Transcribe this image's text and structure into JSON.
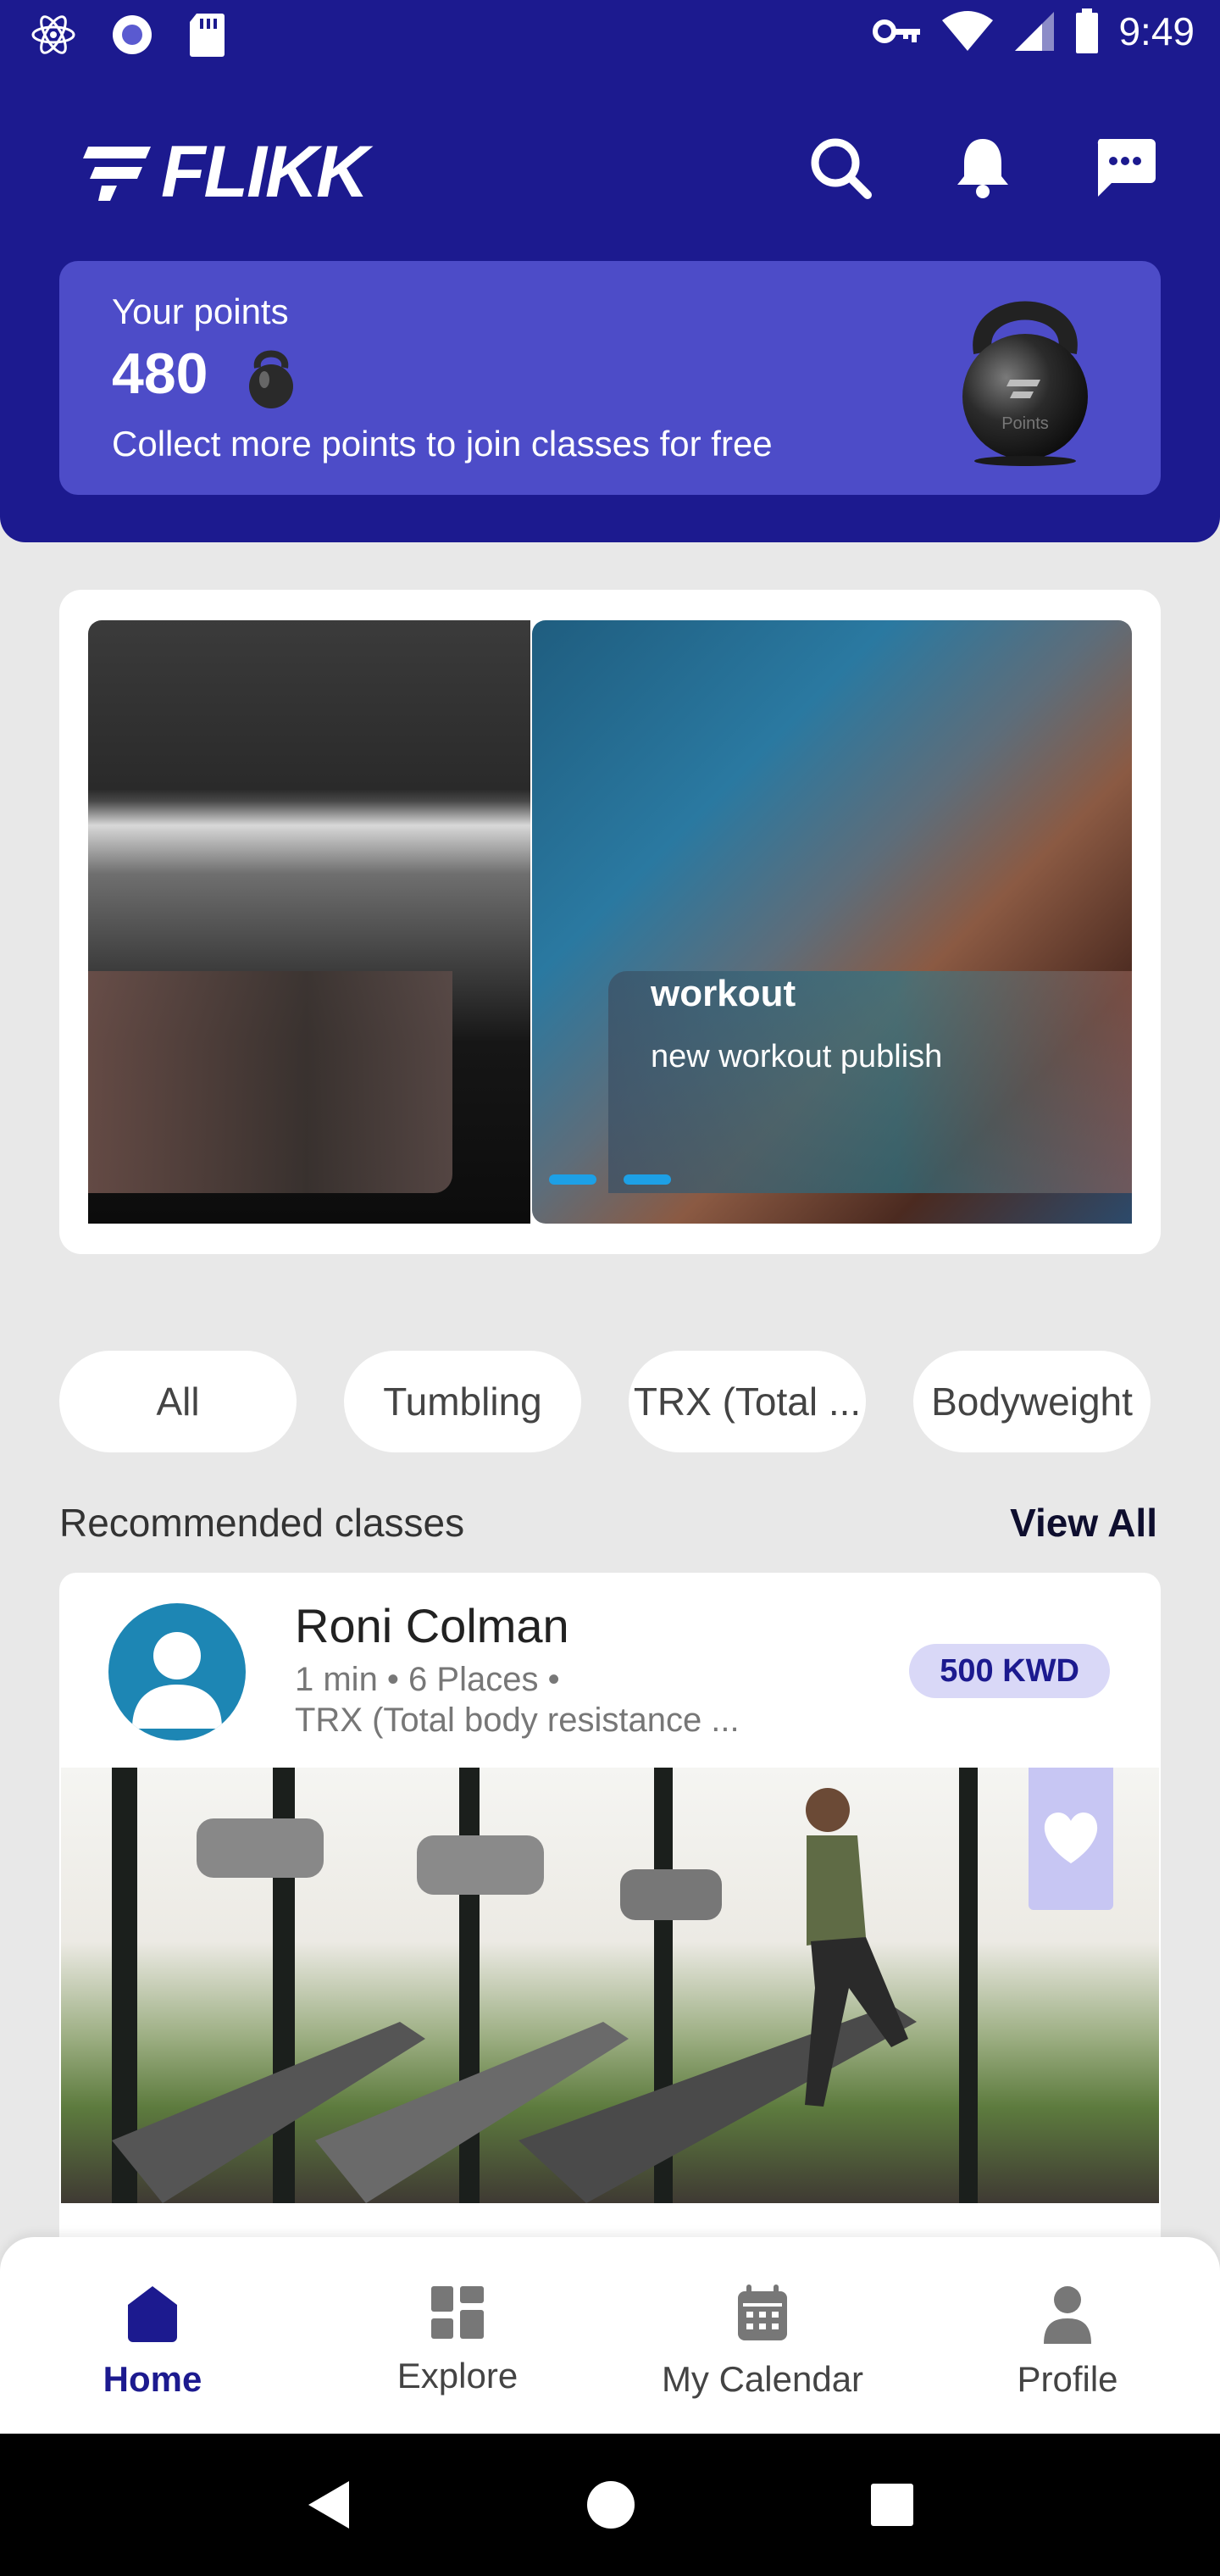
{
  "status_bar": {
    "time": "9:49",
    "icons": [
      "atom-icon",
      "circle-record-icon",
      "sd-card-icon",
      "key-icon",
      "wifi-icon",
      "signal-icon",
      "battery-icon"
    ]
  },
  "header": {
    "logo_text": "FLIKK",
    "icons": [
      "search-icon",
      "bell-icon",
      "chat-icon"
    ]
  },
  "points": {
    "label": "Your points",
    "value": "480",
    "description": "Collect more points to join classes for free",
    "kettlebell_text": "Points"
  },
  "carousel": {
    "slides": [
      {
        "title": "",
        "subtitle": ""
      },
      {
        "title": "workout",
        "subtitle": "new workout publish"
      }
    ],
    "indicator_count": 2
  },
  "categories": [
    "All",
    "Tumbling",
    "TRX (Total ...",
    "Bodyweight"
  ],
  "recommended": {
    "title": "Recommended classes",
    "view_all": "View All"
  },
  "class_card": {
    "trainer": "Roni Colman",
    "meta_line1": "1 min • 6 Places •",
    "meta_line2": "TRX (Total body resistance ...",
    "price": "500 KWD"
  },
  "bottom_nav": [
    {
      "label": "Home",
      "icon": "home-icon",
      "active": true
    },
    {
      "label": "Explore",
      "icon": "grid-icon",
      "active": false
    },
    {
      "label": "My Calendar",
      "icon": "calendar-icon",
      "active": false
    },
    {
      "label": "Profile",
      "icon": "person-icon",
      "active": false
    }
  ],
  "colors": {
    "brand": "#1c1a8f",
    "points_card": "#4d4cc8",
    "indicator": "#1da0e6",
    "price_bg": "#d9d8f7"
  }
}
